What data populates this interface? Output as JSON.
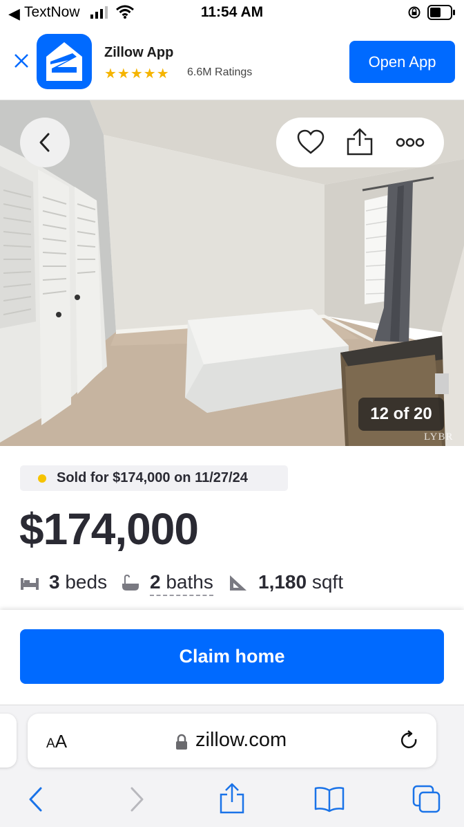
{
  "status_bar": {
    "back_glyph": "◀",
    "carrier": "TextNow",
    "time": "11:54 AM",
    "icons": [
      "signal-icon",
      "wifi-icon",
      "orientation-lock-icon",
      "battery-icon"
    ]
  },
  "app_banner": {
    "app_name": "Zillow App",
    "stars": "★★★★★",
    "ratings": "6.6M Ratings",
    "open_label": "Open App",
    "accent": "#006aff"
  },
  "photo": {
    "counter": "12 of 20",
    "watermark": "LYBR"
  },
  "listing": {
    "sold_text": "Sold for $174,000 on 11/27/24",
    "price": "$174,000",
    "beds_value": "3",
    "beds_label": "beds",
    "baths_value": "2",
    "baths_label": "baths",
    "sqft_value": "1,180",
    "sqft_label": "sqft"
  },
  "cta": {
    "claim_label": "Claim home"
  },
  "browser": {
    "text_size_label_small": "A",
    "text_size_label_large": "A",
    "url": "zillow.com"
  }
}
